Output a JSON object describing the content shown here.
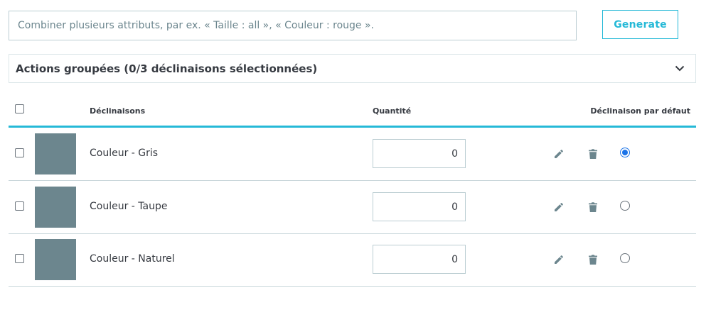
{
  "attributes": {
    "placeholder": "Combiner plusieurs attributs, par ex. « Taille : all », « Couleur : rouge ».",
    "generate_label": "Generate"
  },
  "bulk_actions": {
    "title": "Actions groupées (0/3 déclinaisons sélectionnées)",
    "icon": "chevron-down-icon"
  },
  "table": {
    "headers": {
      "combinations": "Déclinaisons",
      "quantity": "Quantité",
      "default": "Déclinaison par défaut"
    },
    "rows": [
      {
        "label": "Couleur - Gris",
        "quantity": "0",
        "default": true
      },
      {
        "label": "Couleur - Taupe",
        "quantity": "0",
        "default": false
      },
      {
        "label": "Couleur - Naturel",
        "quantity": "0",
        "default": false
      }
    ]
  },
  "icons": {
    "edit": "pencil-icon",
    "delete": "trash-icon"
  },
  "colors": {
    "accent": "#25b9d7",
    "swatch": "#6c868e",
    "radio_selected": "#1a73e8"
  }
}
